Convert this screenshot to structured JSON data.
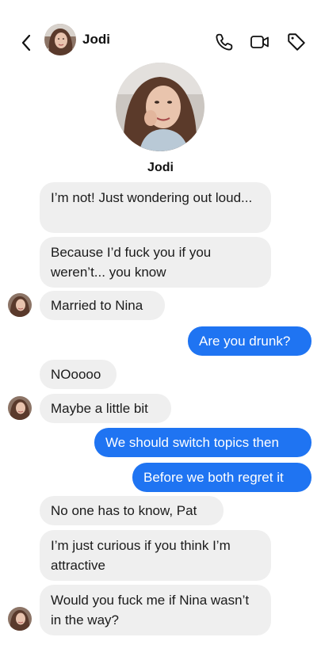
{
  "header": {
    "contact_name": "Jodi",
    "icons": [
      "back-chevron-icon",
      "phone-icon",
      "video-icon",
      "tag-icon"
    ]
  },
  "profile": {
    "name": "Jodi"
  },
  "messages": [
    {
      "direction": "incoming",
      "text": "I’m not! Just wondering out loud..."
    },
    {
      "direction": "incoming",
      "text": "Because I’d fuck you if you weren’t... you know"
    },
    {
      "direction": "incoming",
      "text": "Married to Nina",
      "show_avatar": true
    },
    {
      "direction": "outgoing",
      "text": "Are you drunk?"
    },
    {
      "direction": "incoming",
      "text": "NOoooo"
    },
    {
      "direction": "incoming",
      "text": "Maybe a little bit",
      "show_avatar": true
    },
    {
      "direction": "outgoing",
      "text": "We should switch topics then"
    },
    {
      "direction": "outgoing",
      "text": "Before we both regret it"
    },
    {
      "direction": "incoming",
      "text": "No one has to know, Pat"
    },
    {
      "direction": "incoming",
      "text": "I’m just curious if you think I’m attractive"
    },
    {
      "direction": "incoming",
      "text": "Would you fuck me if Nina wasn’t in the way?",
      "show_avatar": true
    }
  ],
  "colors": {
    "outgoing_bubble": "#1f74f2",
    "incoming_bubble": "#efefef",
    "background": "#ffffff"
  }
}
